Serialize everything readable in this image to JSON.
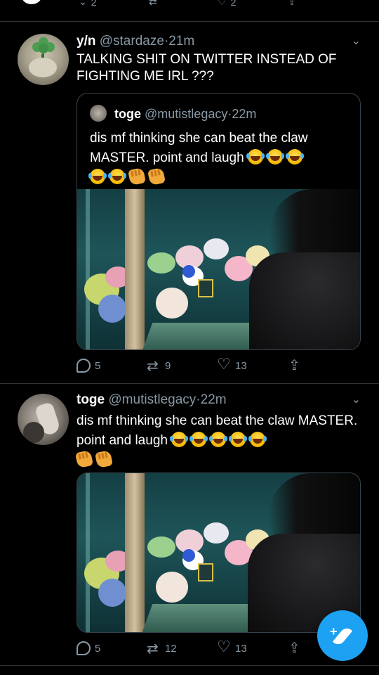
{
  "top_actions": {
    "reply_count": "2",
    "like_count": "2"
  },
  "tweets": [
    {
      "name": "y/n",
      "handle": "@stardaze",
      "dot": "·",
      "time": "21m",
      "text": "TALKING SHIT ON TWITTER INSTEAD OF FIGHTING ME IRL ???",
      "quote": {
        "name": "toge",
        "handle": "@mutistlegacy",
        "dot": "·",
        "time": "22m",
        "text": "dis mf thinking she can beat the claw MASTER. point and laugh"
      },
      "replies": "5",
      "retweets": "9",
      "likes": "13"
    },
    {
      "name": "toge",
      "handle": "@mutistlegacy",
      "dot": "·",
      "time": "22m",
      "text": "dis mf thinking she can beat the claw MASTER. point and laugh",
      "replies": "5",
      "retweets": "12",
      "likes": "13"
    }
  ],
  "icons": {
    "chevron": "chevron-down-icon",
    "reply": "reply-icon",
    "retweet": "retweet-icon",
    "like": "heart-icon",
    "share": "share-icon",
    "compose": "compose-tweet-icon"
  },
  "colors": {
    "accent": "#1da1f2",
    "muted": "#8899a6",
    "background": "#000000"
  }
}
